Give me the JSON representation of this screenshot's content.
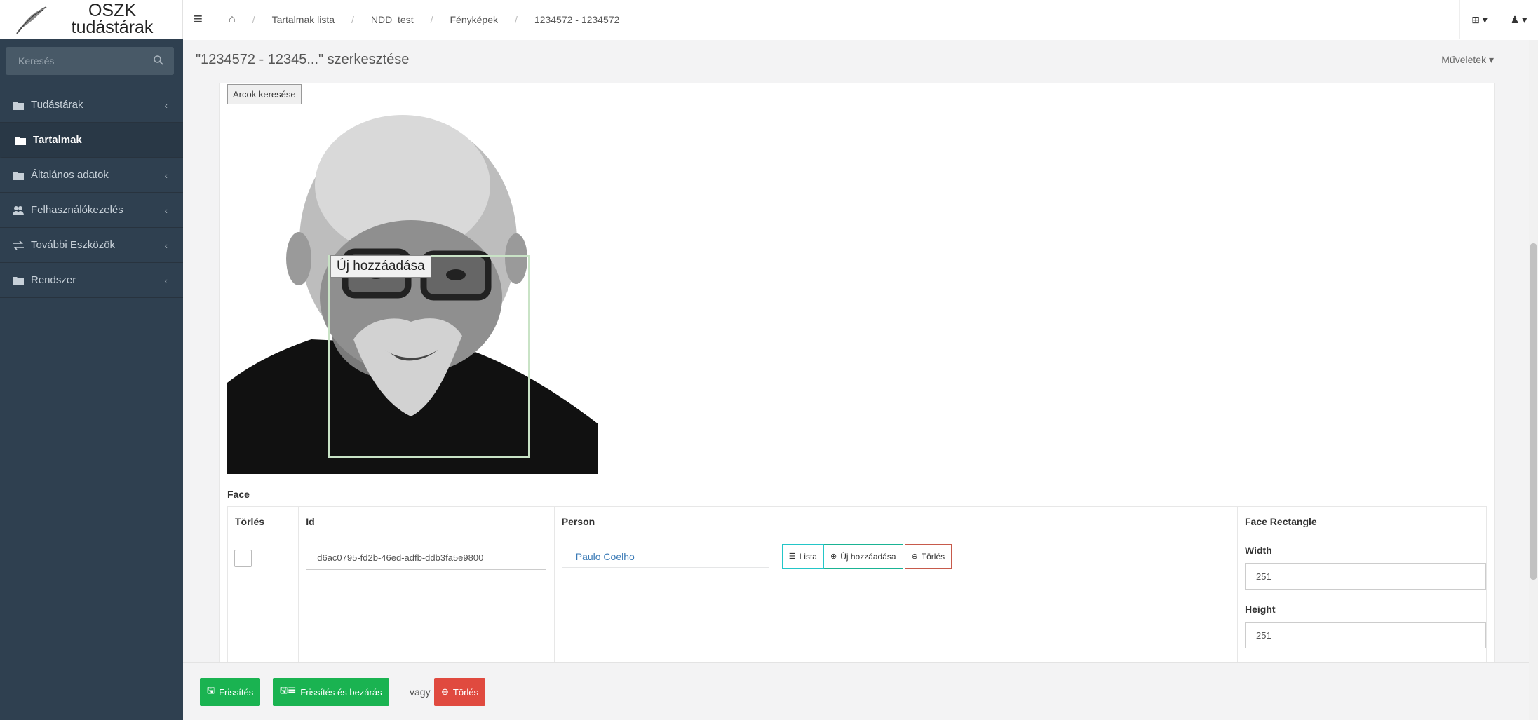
{
  "logo": {
    "line1": "OSZK",
    "line2": "tudástárak"
  },
  "breadcrumb": [
    "Tartalmak lista",
    "NDD_test",
    "Fényképek",
    "1234572 - 1234572"
  ],
  "topbar": {
    "menu_icon": "hamburger-icon",
    "home_icon": "home-icon",
    "add_icon": "plus-square-icon",
    "user_icon": "user-icon"
  },
  "sidebar": {
    "search_placeholder": "Keresés",
    "items": [
      {
        "label": "Tudástárak",
        "icon": "folder-icon",
        "has_children": true
      },
      {
        "label": "Tartalmak",
        "icon": "folder-icon",
        "has_children": false,
        "active": true
      },
      {
        "label": "Általános adatok",
        "icon": "folder-icon",
        "has_children": true
      },
      {
        "label": "Felhasználókezelés",
        "icon": "users-icon",
        "has_children": true
      },
      {
        "label": "További Eszközök",
        "icon": "exchange-icon",
        "has_children": true
      },
      {
        "label": "Rendszer",
        "icon": "folder-icon",
        "has_children": true
      }
    ]
  },
  "header": {
    "title": "\"1234572 - 12345...\" szerkesztése",
    "actions_label": "Műveletek"
  },
  "main": {
    "find_faces_label": "Arcok keresése",
    "face_overlay_label": "Új hozzáadása",
    "face_section_title": "Face",
    "table": {
      "columns": [
        "Törlés",
        "Id",
        "Person",
        "Face Rectangle"
      ],
      "row": {
        "id": "d6ac0795-fd2b-46ed-adfb-ddb3fa5e9800",
        "person": "Paulo Coelho",
        "list_label": "Lista",
        "add_label": "Új hozzáadása",
        "delete_label": "Törlés",
        "width_label": "Width",
        "width_value": "251",
        "height_label": "Height",
        "height_value": "251"
      }
    }
  },
  "footer": {
    "update_label": "Frissítés",
    "update_close_label": "Frissítés és bezárás",
    "or_label": "vagy",
    "delete_label": "Törlés"
  },
  "colors": {
    "sidebar_bg": "#2f4050",
    "primary_green": "#1ab351",
    "danger_red": "#e04a3f",
    "link_blue": "#3a7ab6"
  }
}
